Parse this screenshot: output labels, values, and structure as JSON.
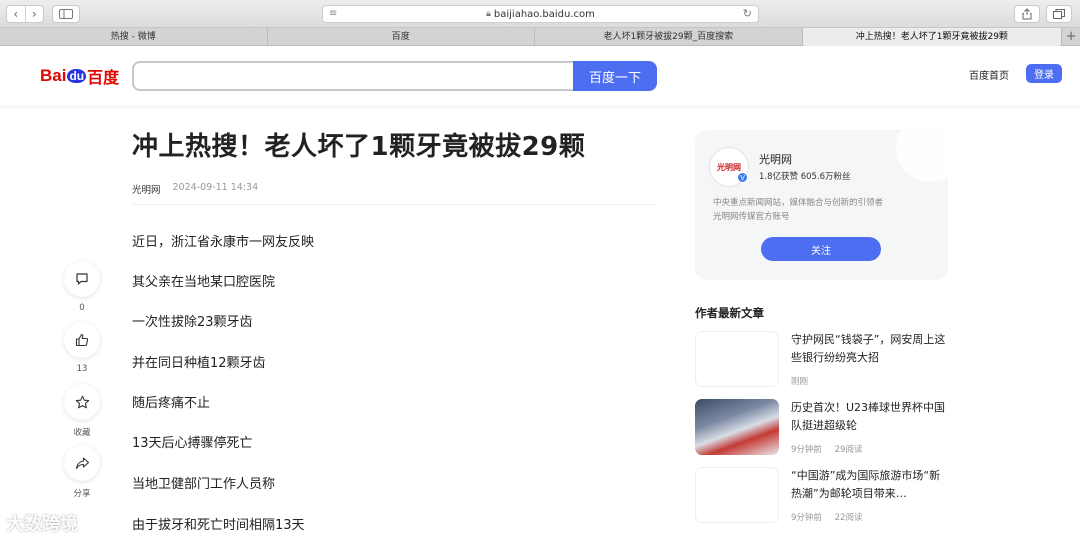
{
  "browser": {
    "address": "baijiahao.baidu.com",
    "nav_back": "‹",
    "nav_forward": "›",
    "tabs": [
      {
        "label": "热搜 - 微博"
      },
      {
        "label": "百度"
      },
      {
        "label": "老人坏1颗牙被拔29颗_百度搜索"
      },
      {
        "label": "冲上热搜！老人坏了1颗牙竟被拔29颗"
      }
    ],
    "new_tab": "+"
  },
  "header": {
    "logo_bai": "Bai",
    "logo_du": "du",
    "logo_cn": "百度",
    "search_button": "百度一下",
    "home_link": "百度首页",
    "login_button": "登录"
  },
  "article": {
    "title": "冲上热搜！老人坏了1颗牙竟被拔29颗",
    "source": "光明网",
    "date": "2024-09-11 14:34",
    "paragraphs": [
      "近日，浙江省永康市一网友反映",
      "其父亲在当地某口腔医院",
      "一次性拔除23颗牙齿",
      "并在同日种植12颗牙齿",
      "随后疼痛不止",
      "13天后心搏骤停死亡",
      "当地卫健部门工作人员称",
      "由于拔牙和死亡时间相隔13天"
    ]
  },
  "actions": {
    "comment_count": "0",
    "like_count": "13",
    "collect_label": "收藏",
    "share_label": "分享"
  },
  "author": {
    "name": "光明网",
    "stats": "1.8亿获赞 605.6万粉丝",
    "desc_line1": "中央重点新闻网站，媒体融合与创新的引领者",
    "desc_line2": "光明网传媒官方账号",
    "follow_button": "关注",
    "avatar_text": "光明网"
  },
  "related": {
    "title": "作者最新文章",
    "items": [
      {
        "title": "守护网民“钱袋子”，网安周上这些银行纷纷亮大招",
        "time": "刚刚",
        "reads": ""
      },
      {
        "title": "历史首次！U23棒球世界杯中国队挺进超级轮",
        "time": "9分钟前",
        "reads": "29阅读"
      },
      {
        "title": "“中国游”成为国际旅游市场“新热潮”为邮轮项目带来…",
        "time": "9分钟前",
        "reads": "22阅读"
      }
    ]
  },
  "watermark": "大数跨境"
}
